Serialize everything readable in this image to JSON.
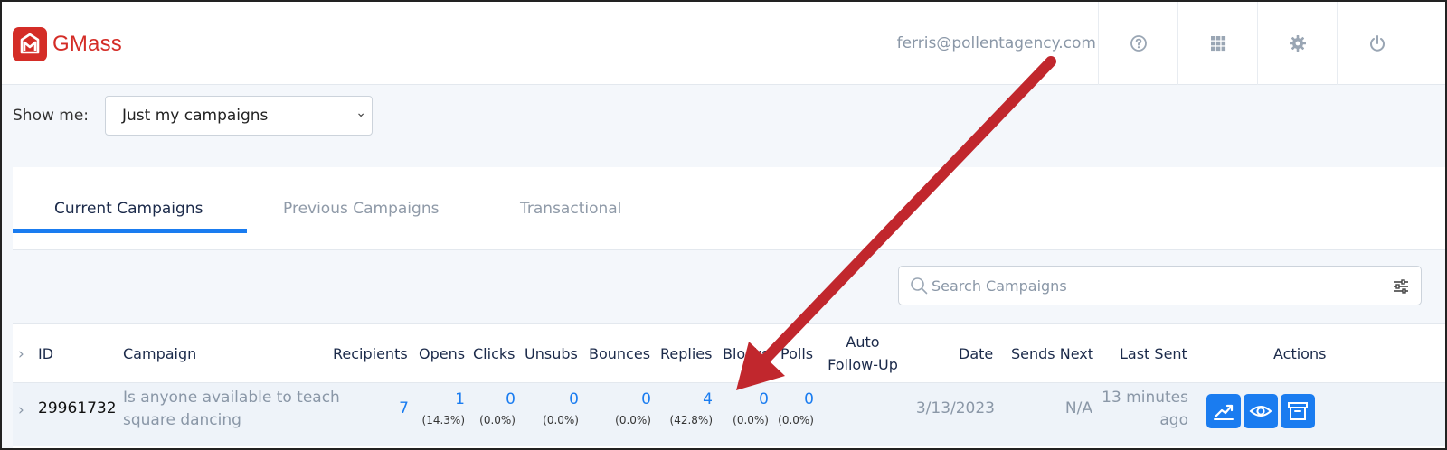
{
  "header": {
    "app_name": "GMass",
    "user_email": "ferris@pollentagency.com",
    "icons": [
      "help-icon",
      "apps-grid-icon",
      "gear-icon",
      "power-icon"
    ]
  },
  "filter": {
    "label": "Show me:",
    "selected": "Just my campaigns"
  },
  "tabs": [
    {
      "label": "Current Campaigns",
      "active": true
    },
    {
      "label": "Previous Campaigns",
      "active": false
    },
    {
      "label": "Transactional",
      "active": false
    }
  ],
  "search": {
    "placeholder": "Search Campaigns"
  },
  "table": {
    "columns": [
      "ID",
      "Campaign",
      "Recipients",
      "Opens",
      "Clicks",
      "Unsubs",
      "Bounces",
      "Replies",
      "Blocks",
      "Polls",
      "Auto",
      "Follow-Up",
      "Date",
      "Sends Next",
      "Last Sent",
      "Actions"
    ],
    "rows": [
      {
        "id": "29961732",
        "campaign_line1": "Is anyone available to teach",
        "campaign_line2": "square dancing",
        "recipients": "7",
        "opens": "1",
        "opens_pct": "(14.3%)",
        "clicks": "0",
        "clicks_pct": "(0.0%)",
        "unsubs": "0",
        "unsubs_pct": "(0.0%)",
        "bounces": "0",
        "bounces_pct": "(0.0%)",
        "replies": "4",
        "replies_pct": "(42.8%)",
        "blocks": "0",
        "blocks_pct": "(0.0%)",
        "polls": "0",
        "polls_pct": "(0.0%)",
        "date": "3/13/2023",
        "sends_next": "N/A",
        "last_sent_line1": "13 minutes",
        "last_sent_line2": "ago"
      }
    ]
  },
  "colors": {
    "brand_red": "#d42d27",
    "accent_blue": "#1a7cf0",
    "annotation_arrow": "#c1272d"
  }
}
